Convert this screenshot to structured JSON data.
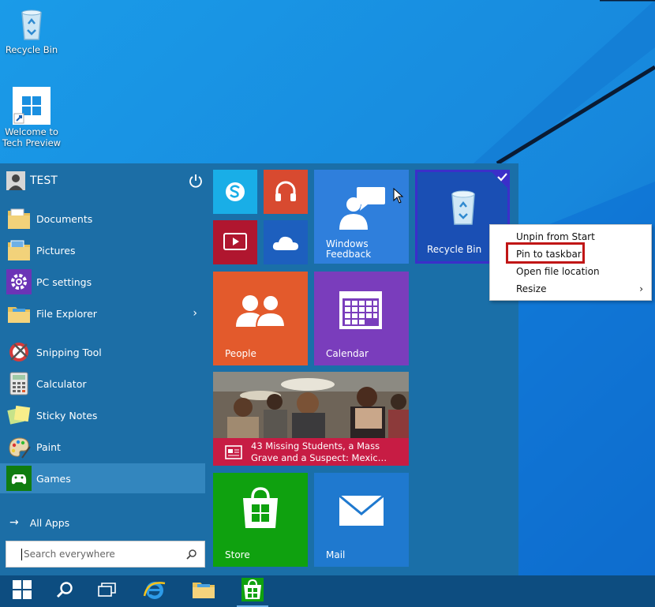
{
  "desktop": {
    "icons": [
      {
        "label": "Recycle Bin",
        "icon": "recycle-bin-icon"
      },
      {
        "label": "Welcome to Tech Preview",
        "icon": "windows-logo-icon"
      }
    ]
  },
  "start_menu": {
    "user": {
      "name": "TEST",
      "icon": "user-avatar-icon"
    },
    "power_icon": "power-icon",
    "places": [
      {
        "label": "Documents",
        "icon": "documents-folder-icon"
      },
      {
        "label": "Pictures",
        "icon": "pictures-folder-icon"
      },
      {
        "label": "PC settings",
        "icon": "gear-icon"
      },
      {
        "label": "File Explorer",
        "icon": "file-explorer-icon",
        "submenu_arrow": "›"
      }
    ],
    "apps": [
      {
        "label": "Snipping Tool",
        "icon": "snipping-tool-icon"
      },
      {
        "label": "Calculator",
        "icon": "calculator-icon"
      },
      {
        "label": "Sticky Notes",
        "icon": "sticky-notes-icon"
      },
      {
        "label": "Paint",
        "icon": "paint-icon"
      },
      {
        "label": "Games",
        "icon": "games-controller-icon",
        "selected": true
      }
    ],
    "all_apps": {
      "label": "All Apps",
      "arrow": "→"
    },
    "search": {
      "placeholder": "Search everywhere"
    }
  },
  "tiles": {
    "skype": {
      "icon": "skype-icon",
      "color": "#19aee7"
    },
    "music": {
      "icon": "headphones-icon",
      "color": "#d84a30"
    },
    "video": {
      "icon": "video-icon",
      "color": "#b0162f"
    },
    "onedrive": {
      "icon": "cloud-icon",
      "color": "#1d5fbe"
    },
    "windows_feedback": {
      "label": "Windows Feedback",
      "label_line1": "Windows",
      "label_line2": "Feedback",
      "color": "#2f7fdc"
    },
    "recycle_bin": {
      "label": "Recycle Bin",
      "color": "#1a4fb4",
      "selected": true
    },
    "people": {
      "label": "People",
      "color": "#e35a2c"
    },
    "calendar": {
      "label": "Calendar",
      "color": "#7a3dbc"
    },
    "news": {
      "headline": "43 Missing Students, a Mass Grave and a Suspect: Mexic…",
      "headline_line1": "43 Missing Students, a Mass",
      "headline_line2": "Grave and a Suspect: Mexic…",
      "color": "#c71c44"
    },
    "store": {
      "label": "Store",
      "color": "#0fa10f"
    },
    "mail": {
      "label": "Mail",
      "color": "#1f79cf"
    }
  },
  "context_menu": {
    "items": [
      {
        "label": "Unpin from Start"
      },
      {
        "label": "Pin to taskbar",
        "highlighted": true
      },
      {
        "label": "Open file location"
      },
      {
        "label": "Resize",
        "submenu_arrow": "›"
      }
    ]
  },
  "taskbar": {
    "buttons": [
      {
        "name": "start-button",
        "icon": "windows-logo-icon"
      },
      {
        "name": "search-button",
        "icon": "search-icon"
      },
      {
        "name": "task-view-button",
        "icon": "task-view-icon"
      },
      {
        "name": "internet-explorer-button",
        "icon": "internet-explorer-icon"
      },
      {
        "name": "file-explorer-taskbar-button",
        "icon": "folder-icon"
      },
      {
        "name": "store-taskbar-button",
        "icon": "store-icon"
      }
    ]
  }
}
